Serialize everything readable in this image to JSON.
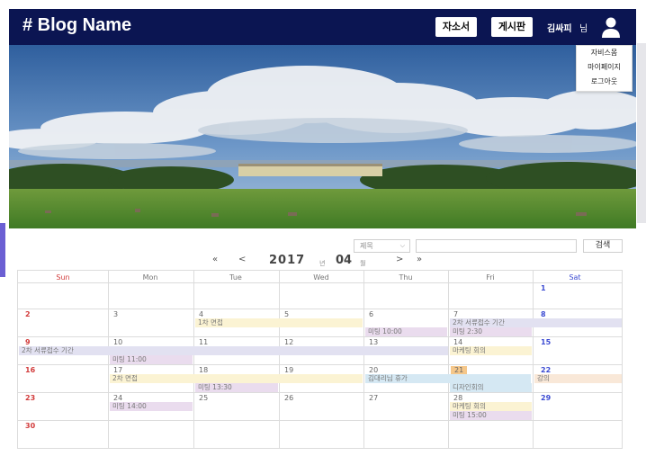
{
  "header": {
    "brand": "# Blog Name",
    "nav": {
      "resume": "자소서",
      "board": "게시판"
    },
    "user": {
      "name": "김싸피",
      "suffix": "님"
    }
  },
  "user_menu": [
    "자비스몸",
    "마이페이지",
    "로그아웃"
  ],
  "search": {
    "select_value": "제목",
    "button": "검색"
  },
  "calendar": {
    "nav": {
      "prev_year": "«",
      "prev_month": "<",
      "next_month": ">",
      "next_year": "»"
    },
    "year": "2017",
    "year_unit": "년",
    "month": "04",
    "month_unit": "월",
    "days": [
      "Sun",
      "Mon",
      "Tue",
      "Wed",
      "Thu",
      "Fri",
      "Sat"
    ],
    "dates": [
      "1",
      "2",
      "3",
      "4",
      "5",
      "6",
      "7",
      "8",
      "9",
      "10",
      "11",
      "12",
      "13",
      "14",
      "15",
      "16",
      "17",
      "18",
      "19",
      "20",
      "21",
      "22",
      "23",
      "24",
      "25",
      "26",
      "27",
      "28",
      "29",
      "30"
    ],
    "events": [
      "1차 면접",
      "2차 서류접수 기간",
      "미팅 10:00",
      "미팅 2:30",
      "2차 서류접수 기간",
      "미팅 11:00",
      "마케팅 회의",
      "2차 면접",
      "김대리님 휴가",
      "강의",
      "미팅 13:30",
      "디자인회의",
      "미팅 14:00",
      "마케팅 회의",
      "미팅 15:00"
    ]
  },
  "colors": {
    "navbar": "#0b1552",
    "sunday": "#d23c3c",
    "saturday": "#3c4bd2",
    "today_highlight": "#f5c78a"
  }
}
